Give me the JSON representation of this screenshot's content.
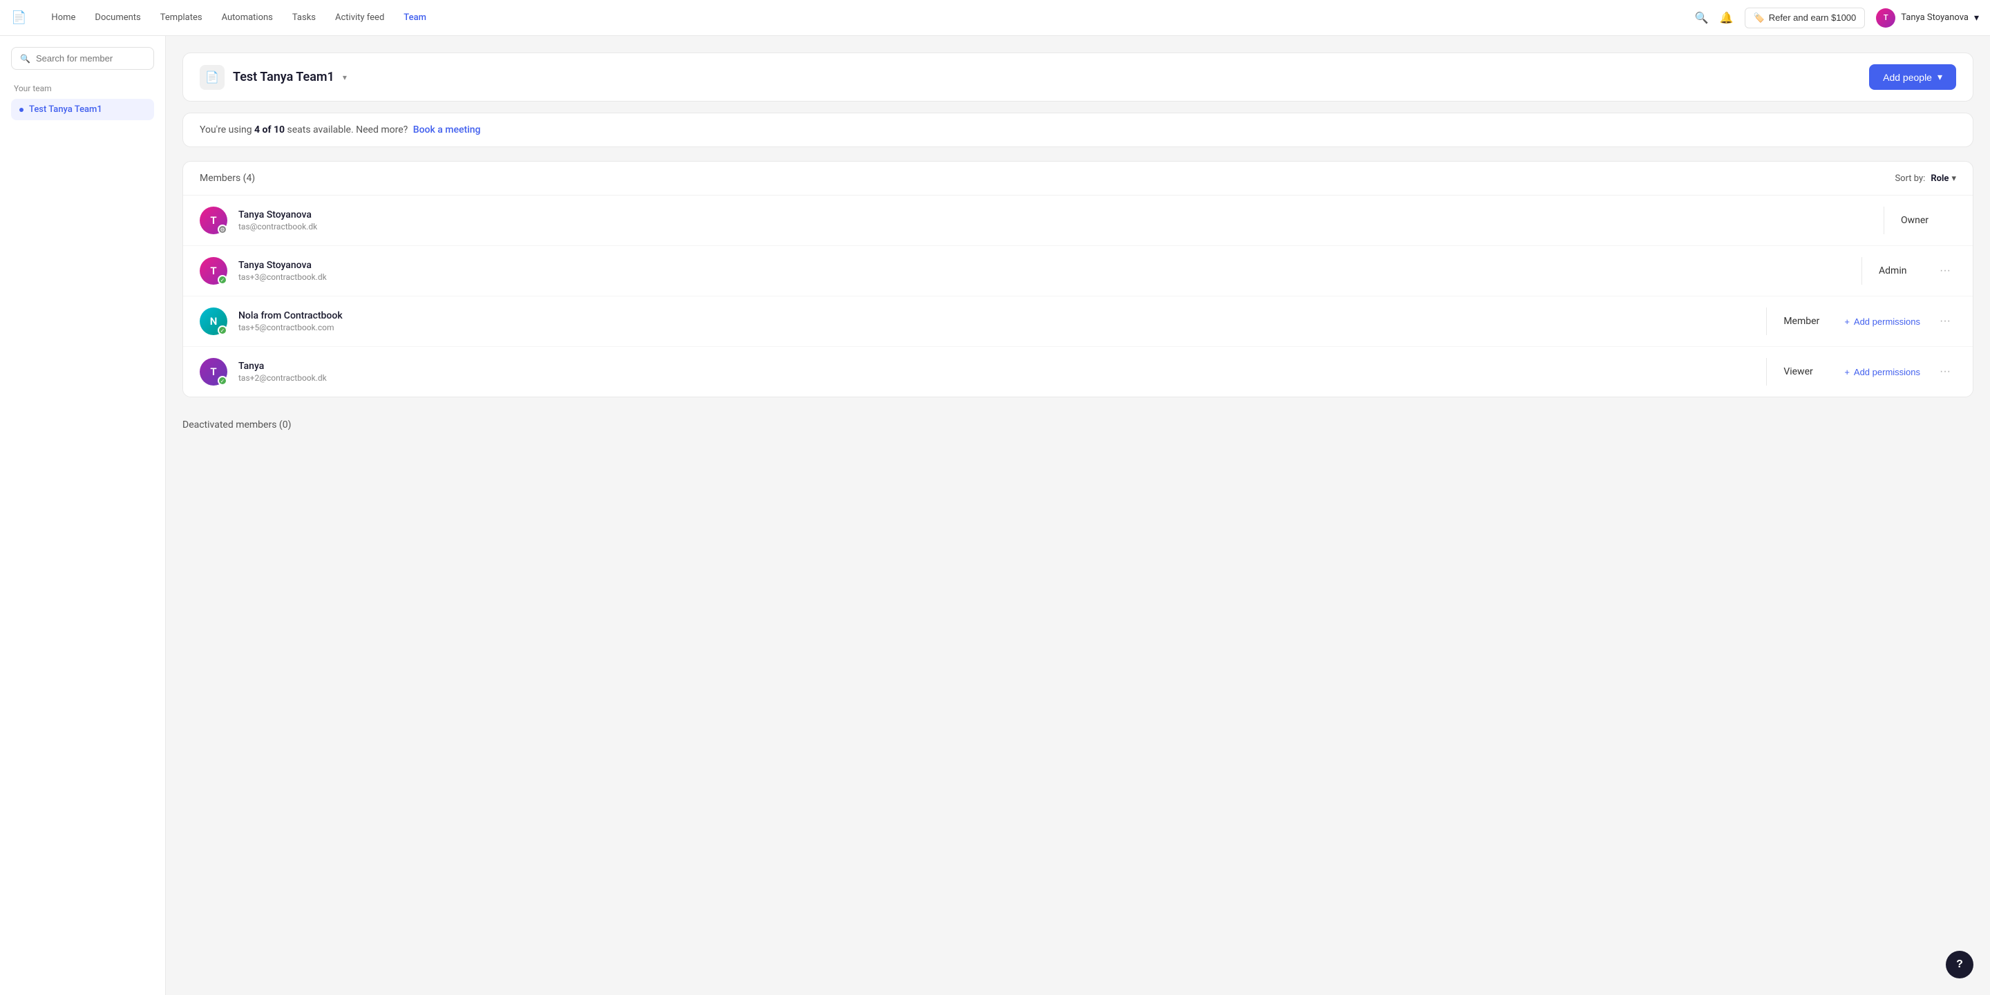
{
  "nav": {
    "logo": "📄",
    "links": [
      {
        "label": "Home",
        "active": false
      },
      {
        "label": "Documents",
        "active": false
      },
      {
        "label": "Templates",
        "active": false
      },
      {
        "label": "Automations",
        "active": false
      },
      {
        "label": "Tasks",
        "active": false
      },
      {
        "label": "Activity feed",
        "active": false
      },
      {
        "label": "Team",
        "active": true
      }
    ],
    "refer_label": "Refer and earn $1000",
    "user_name": "Tanya Stoyanova",
    "user_initials": "T"
  },
  "sidebar": {
    "search_placeholder": "Search for member",
    "section_label": "Your team",
    "items": [
      {
        "label": "Test Tanya Team1",
        "active": true
      }
    ]
  },
  "team": {
    "icon": "📄",
    "name": "Test Tanya Team1",
    "add_people_label": "Add people"
  },
  "seats": {
    "text_before": "You're using ",
    "used": "4 of 10",
    "text_after": " seats available. Need more?",
    "link_label": "Book a meeting"
  },
  "members": {
    "header_label": "Members (4)",
    "sort_label": "Sort by:",
    "sort_value": "Role",
    "list": [
      {
        "name": "Tanya Stoyanova",
        "email": "tas@contractbook.dk",
        "role": "Owner",
        "initials": "T",
        "avatar_class": "avatar-pink",
        "status": "settings",
        "show_actions": false
      },
      {
        "name": "Tanya Stoyanova",
        "email": "tas+3@contractbook.dk",
        "role": "Admin",
        "initials": "T",
        "avatar_class": "avatar-pink",
        "status": "green",
        "show_actions": true
      },
      {
        "name": "Nola from Contractbook",
        "email": "tas+5@contractbook.com",
        "role": "Member",
        "initials": "N",
        "avatar_class": "avatar-teal",
        "status": "green",
        "show_actions": true,
        "add_permissions_label": "Add permissions"
      },
      {
        "name": "Tanya",
        "email": "tas+2@contractbook.dk",
        "role": "Viewer",
        "initials": "T",
        "avatar_class": "avatar-purple",
        "status": "green",
        "show_actions": true,
        "add_permissions_label": "Add permissions"
      }
    ]
  },
  "deactivated": {
    "label": "Deactivated members (0)"
  },
  "help": {
    "label": "?"
  }
}
